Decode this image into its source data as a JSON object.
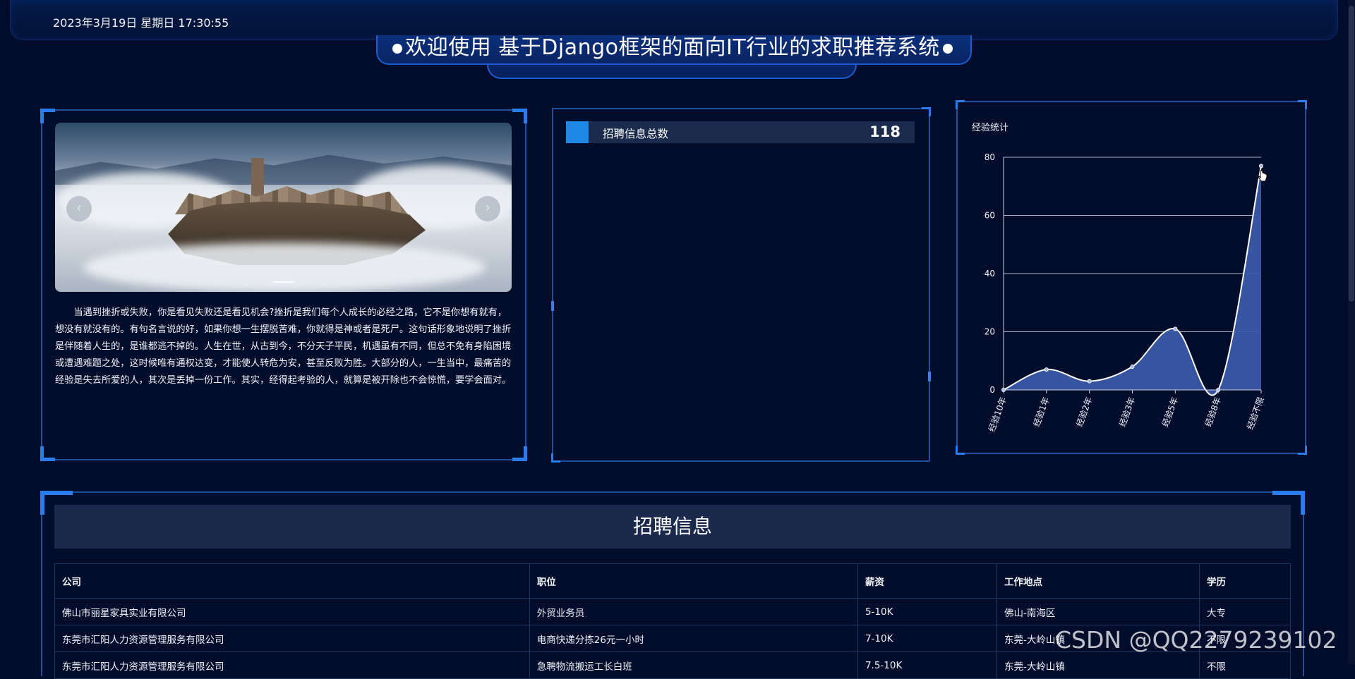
{
  "header": {
    "datetime": "2023年3月19日 星期日 17:30:55",
    "title": "欢迎使用 基于Django框架的面向IT行业的求职推荐系统"
  },
  "left_panel": {
    "carousel": {
      "prev_icon": "‹",
      "next_icon": "›"
    },
    "essay": "当遇到挫折或失败，你是看见失败还是看见机会?挫折是我们每个人成长的必经之路，它不是你想有就有，想没有就没有的。有句名言说的好，如果你想一生摆脱苦难，你就得是神或者是死尸。这句话形象地说明了挫折是伴随着人生的，是谁都逃不掉的。人生在世，从古到今，不分天子平民，机遇虽有不同，但总不免有身陷困境或遭遇难题之处，这时候唯有通权达变，才能使人转危为安，甚至反败为胜。大部分的人，一生当中，最痛苦的经验是失去所爱的人，其次是丢掉一份工作。其实，经得起考验的人，就算是被开除也不会惊慌，要学会面对。"
  },
  "mid_panel": {
    "stat_label": "招聘信息总数",
    "stat_value": "118",
    "accent": "#1e88e5"
  },
  "right_panel": {
    "chart_title": "经验统计"
  },
  "chart_data": {
    "type": "area",
    "title": "经验统计",
    "categories": [
      "经验10年",
      "经验1年",
      "经验2年",
      "经验3年",
      "经验5年",
      "经验8年",
      "经验不限"
    ],
    "series": [
      {
        "values": [
          0,
          7,
          3,
          8,
          21,
          0,
          77
        ]
      }
    ],
    "ylim": [
      0,
      80
    ],
    "yticks": [
      0,
      20,
      40,
      60,
      80
    ],
    "grid": true,
    "fill_color": "#3a58a8",
    "line_color": "#ffffff"
  },
  "bottom_panel": {
    "section_title": "招聘信息",
    "columns": [
      "公司",
      "职位",
      "薪资",
      "工作地点",
      "学历"
    ],
    "rows": [
      [
        "佛山市丽星家具实业有限公司",
        "外贸业务员",
        "5-10K",
        "佛山-南海区",
        "大专"
      ],
      [
        "东莞市汇阳人力资源管理服务有限公司",
        "电商快递分拣26元一小时",
        "7-10K",
        "东莞-大岭山镇",
        "不限"
      ],
      [
        "东莞市汇阳人力资源管理服务有限公司",
        "急聘物流搬运工长白班",
        "7.5-10K",
        "东莞-大岭山镇",
        "不限"
      ]
    ]
  },
  "watermark": "CSDN @QQ2279239102"
}
